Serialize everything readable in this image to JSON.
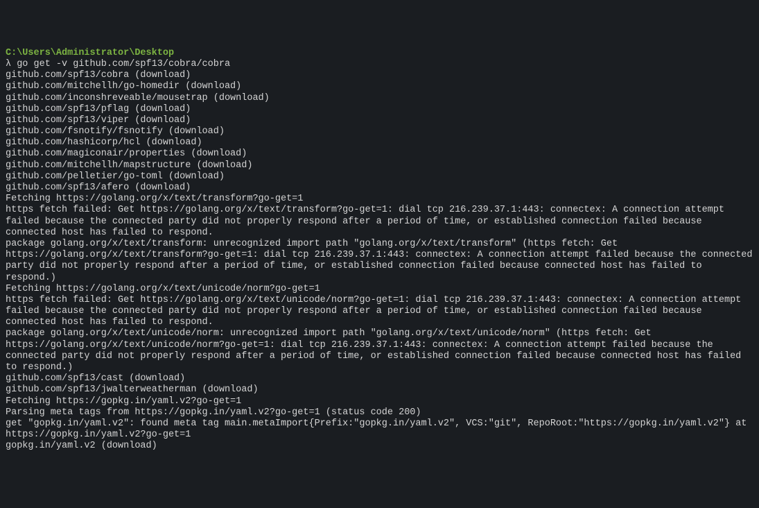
{
  "path": "C:\\Users\\Administrator\\Desktop",
  "prompt_symbol": "λ ",
  "command": "go get -v github.com/spf13/cobra/cobra",
  "output_lines": [
    "github.com/spf13/cobra (download)",
    "github.com/mitchellh/go-homedir (download)",
    "github.com/inconshreveable/mousetrap (download)",
    "github.com/spf13/pflag (download)",
    "github.com/spf13/viper (download)",
    "github.com/fsnotify/fsnotify (download)",
    "github.com/hashicorp/hcl (download)",
    "github.com/magiconair/properties (download)",
    "github.com/mitchellh/mapstructure (download)",
    "github.com/pelletier/go-toml (download)",
    "github.com/spf13/afero (download)",
    "Fetching https://golang.org/x/text/transform?go-get=1",
    "https fetch failed: Get https://golang.org/x/text/transform?go-get=1: dial tcp 216.239.37.1:443: connectex: A connection attempt failed because the connected party did not properly respond after a period of time, or established connection failed because connected host has failed to respond.",
    "package golang.org/x/text/transform: unrecognized import path \"golang.org/x/text/transform\" (https fetch: Get https://golang.org/x/text/transform?go-get=1: dial tcp 216.239.37.1:443: connectex: A connection attempt failed because the connected party did not properly respond after a period of time, or established connection failed because connected host has failed to respond.)",
    "Fetching https://golang.org/x/text/unicode/norm?go-get=1",
    "https fetch failed: Get https://golang.org/x/text/unicode/norm?go-get=1: dial tcp 216.239.37.1:443: connectex: A connection attempt failed because the connected party did not properly respond after a period of time, or established connection failed because connected host has failed to respond.",
    "package golang.org/x/text/unicode/norm: unrecognized import path \"golang.org/x/text/unicode/norm\" (https fetch: Get https://golang.org/x/text/unicode/norm?go-get=1: dial tcp 216.239.37.1:443: connectex: A connection attempt failed because the connected party did not properly respond after a period of time, or established connection failed because connected host has failed to respond.)",
    "github.com/spf13/cast (download)",
    "github.com/spf13/jwalterweatherman (download)",
    "Fetching https://gopkg.in/yaml.v2?go-get=1",
    "Parsing meta tags from https://gopkg.in/yaml.v2?go-get=1 (status code 200)",
    "get \"gopkg.in/yaml.v2\": found meta tag main.metaImport{Prefix:\"gopkg.in/yaml.v2\", VCS:\"git\", RepoRoot:\"https://gopkg.in/yaml.v2\"} at https://gopkg.in/yaml.v2?go-get=1",
    "gopkg.in/yaml.v2 (download)"
  ]
}
